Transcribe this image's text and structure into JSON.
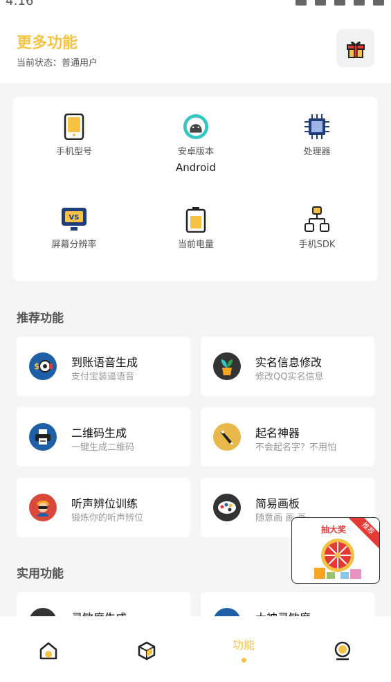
{
  "status": {
    "time": "4:16"
  },
  "header": {
    "title": "更多功能",
    "subtitle": "当前状态：普通用户"
  },
  "device_info": [
    {
      "label": "手机型号",
      "value": ""
    },
    {
      "label": "安卓版本",
      "value": "Android"
    },
    {
      "label": "处理器",
      "value": ""
    },
    {
      "label": "屏幕分辨率",
      "value": ""
    },
    {
      "label": "当前电量",
      "value": ""
    },
    {
      "label": "手机SDK",
      "value": ""
    }
  ],
  "sections": {
    "recommended": "推荐功能",
    "utility": "实用功能"
  },
  "features": [
    {
      "title": "到账语音生成",
      "subtitle": "支付宝装逼语音"
    },
    {
      "title": "实名信息修改",
      "subtitle": "修改QQ实名信息"
    },
    {
      "title": "二维码生成",
      "subtitle": "一键生成二维码"
    },
    {
      "title": "起名神器",
      "subtitle": "不会起名字？不用怕"
    },
    {
      "title": "听声辨位训练",
      "subtitle": "锻炼你的听声辨位"
    },
    {
      "title": "简易画板",
      "subtitle": "随意画 画 画~"
    },
    {
      "title": "灵敏度生成",
      "subtitle": ""
    },
    {
      "title": "大神灵敏度",
      "subtitle": ""
    }
  ],
  "nav": {
    "active_label": "功能"
  },
  "ad": {
    "title": "抽大奖",
    "ribbon": "推荐"
  },
  "colors": {
    "accent": "#f6c244",
    "ad_red": "#e53935"
  }
}
